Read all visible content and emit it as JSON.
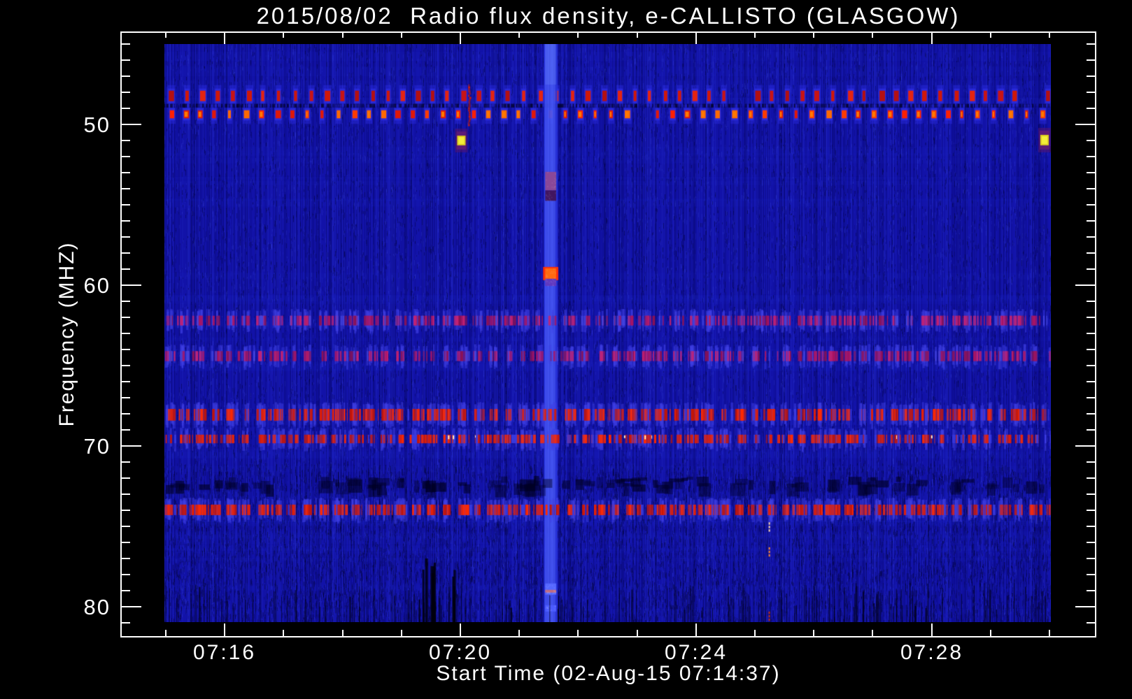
{
  "chart_data": {
    "type": "heatmap",
    "title": "2015/08/02  Radio flux density, e-CALLISTO (GLASGOW)",
    "xlabel": "Start Time (02-Aug-15 07:14:37)",
    "ylabel": "Frequency (MHZ)",
    "station": "GLASGOW",
    "date": "2015/08/02",
    "x_start_time": "07:14:37",
    "x_major_ticks": [
      "07:16",
      "07:20",
      "07:24",
      "07:28"
    ],
    "x_minor_tick_interval_seconds": 60,
    "y_major_ticks": [
      50,
      60,
      70,
      80
    ],
    "y_minor_tick_interval_mhz": 1,
    "data_time_range": [
      "07:15:02",
      "07:30:03"
    ],
    "data_freq_range_mhz": [
      45.0,
      81.0
    ],
    "background_color": "#1212a8",
    "legend": "off",
    "grid": "off",
    "features": [
      {
        "id": "rfi-band-48",
        "kind": "periodic-rfi-band",
        "freq_mhz": [
          47.9,
          48.55
        ],
        "period_seconds": 15.7,
        "start_time": "07:15:03",
        "intensity": "medium",
        "core_colors": [
          "#c81414",
          "#e42410",
          "#d01808",
          "#b41010"
        ],
        "halo_color": "#2d2de0"
      },
      {
        "id": "rfi-band-49",
        "kind": "periodic-rfi-band",
        "freq_mhz": [
          49.12,
          49.62
        ],
        "period_seconds": 15.7,
        "start_time": "07:15:04",
        "intensity": "bright",
        "core_colors": [
          "#ff3c00",
          "#ff2000",
          "#ff6a00",
          "#e01808"
        ],
        "halo_color": "#2d2de0"
      },
      {
        "id": "dark-line-48-8",
        "kind": "dark-line",
        "freq_mhz": [
          48.72,
          48.95
        ]
      },
      {
        "id": "transient-stripe-0721",
        "kind": "transient-stripe",
        "time_range": [
          "07:21:25",
          "07:21:39"
        ],
        "freq_mhz": [
          45.0,
          81.0
        ],
        "base_color": "#3241eb",
        "segments": [
          {
            "freq_mhz": [
              52.95,
              54.1
            ],
            "color": "#8a4898"
          },
          {
            "freq_mhz": [
              54.1,
              54.75
            ],
            "color": "#41155f"
          },
          {
            "freq_mhz": [
              58.95,
              59.6
            ],
            "color": "#ff6a10",
            "glow": "#ff3008"
          },
          {
            "freq_mhz": [
              59.6,
              60.05
            ],
            "color": "#6038c0"
          },
          {
            "freq_mhz": [
              78.55,
              79.25
            ],
            "color": "#5668ff"
          },
          {
            "freq_mhz": [
              78.95,
              79.12
            ],
            "color": "#c06a80"
          },
          {
            "freq_mhz": [
              79.9,
              80.3
            ],
            "color": "#4b5bff"
          }
        ]
      },
      {
        "id": "speckle-62",
        "kind": "speckle-band",
        "freq_mhz": [
          61.9,
          62.5
        ],
        "palette": [
          "#a81463",
          "#c42272",
          "#8a1154",
          "#4343dd"
        ],
        "density": 0.5
      },
      {
        "id": "speckle-64",
        "kind": "speckle-band",
        "freq_mhz": [
          64.1,
          64.72
        ],
        "palette": [
          "#a81463",
          "#c42272",
          "#8a1154",
          "#4343dd"
        ],
        "density": 0.45
      },
      {
        "id": "rfi-68",
        "kind": "speckle-band",
        "freq_mhz": [
          67.7,
          68.42
        ],
        "palette": [
          "#e02008",
          "#ff2a00",
          "#c01408",
          "#3a3ae0"
        ],
        "density": 0.62
      },
      {
        "id": "rfi-69-7",
        "kind": "speckle-band",
        "freq_mhz": [
          69.3,
          69.83
        ],
        "palette": [
          "#e02008",
          "#ff2a00",
          "#c01408",
          "#3a3ae0"
        ],
        "density": 0.5,
        "white_ticks": 8
      },
      {
        "id": "dark-band-72",
        "kind": "dark-band",
        "freq_mhz": [
          71.95,
          72.7
        ]
      },
      {
        "id": "rfi-74",
        "kind": "speckle-band",
        "freq_mhz": [
          73.65,
          74.3
        ],
        "palette": [
          "#e02008",
          "#ff2a00",
          "#c01408",
          "#3a3ae0"
        ],
        "density": 0.64
      },
      {
        "id": "cal-dot-left",
        "kind": "calibration-dot",
        "time": "07:20:01",
        "freq_mhz": [
          50.7,
          51.3
        ],
        "color": "#ddd020",
        "border_color": "#5c1a78"
      },
      {
        "id": "cal-dot-right",
        "kind": "calibration-dot",
        "time": "07:29:55",
        "freq_mhz": [
          50.65,
          51.3
        ],
        "color": "#ddd020",
        "border_color": "#5c1a78"
      },
      {
        "id": "red-streak-0720",
        "kind": "vertical-streak",
        "time": "07:20:09",
        "freq_mhz": [
          47.5,
          50.1
        ],
        "color": "#d41c08"
      },
      {
        "id": "dashed-line-0725",
        "kind": "dashed-line",
        "time": "07:25:14",
        "dashes": [
          {
            "freq_mhz": [
              74.75,
              75.4
            ],
            "color": "#ffd8a8"
          },
          {
            "freq_mhz": [
              76.3,
              76.95
            ],
            "color": "#ff8830"
          },
          {
            "freq_mhz": [
              80.3,
              80.9
            ],
            "color": "#cc3010"
          }
        ]
      },
      {
        "id": "bottom-dropouts",
        "kind": "bottom-dropouts",
        "freq_mhz": [
          78.5,
          81.0
        ]
      }
    ]
  }
}
